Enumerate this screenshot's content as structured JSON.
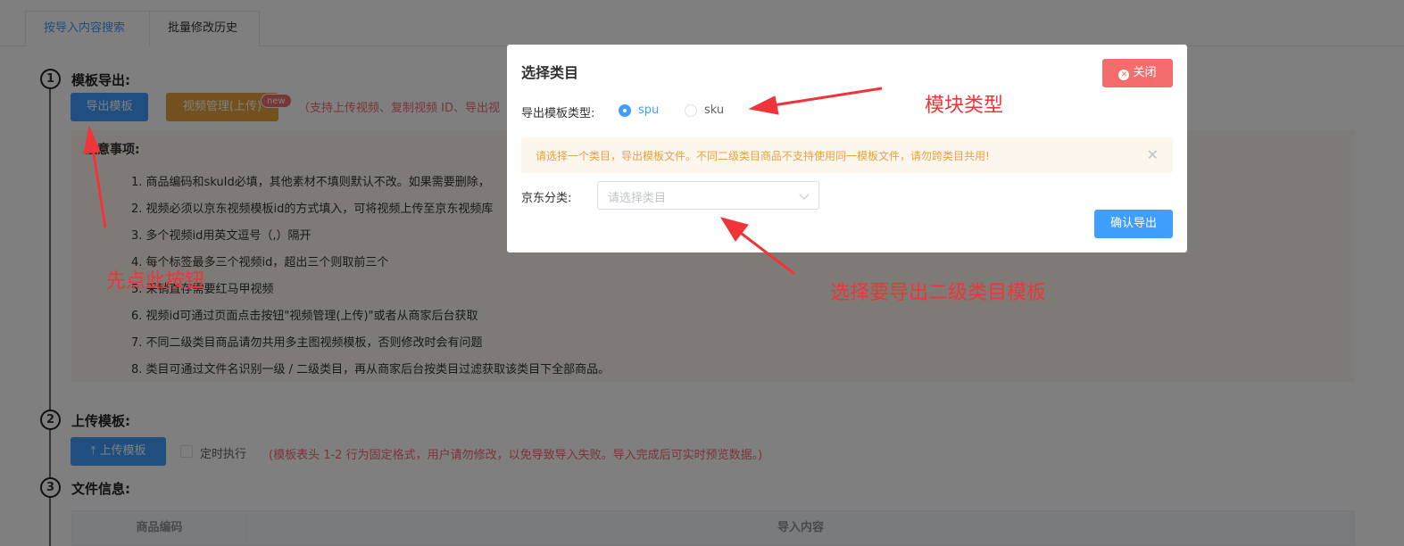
{
  "tabs": [
    {
      "label": "按导入内容搜索",
      "active": true
    },
    {
      "label": "批量修改历史",
      "active": false
    }
  ],
  "steps": [
    {
      "num": "1",
      "title": "模板导出:"
    },
    {
      "num": "2",
      "title": "上传模板:"
    },
    {
      "num": "3",
      "title": "文件信息:"
    }
  ],
  "step1": {
    "export_button": "导出模板",
    "video_button": "视频管理(上传)",
    "new_badge": "new",
    "hint": "（支持上传视频、复制视频 ID、导出视"
  },
  "notice": {
    "title": "注意事项:",
    "items": [
      "1. 商品编码和skuId必填，其他素材不填则默认不改。如果需要删除，",
      "2. 视频必须以京东视频模板id的方式填入，可将视频上传至京东视频库",
      "3. 多个视频id用英文逗号（,）隔开",
      "4. 每个标签最多三个视频id，超出三个则取前三个",
      "5. 采销直存需要红马甲视频",
      "6. 视频id可通过页面点击按钮\"视频管理(上传)\"或者从商家后台获取",
      "7. 不同二级类目商品请勿共用多主图视频模板，否则修改时会有问题",
      "8. 类目可通过文件名识别一级 / 二级类目，再从商家后台按类目过滤获取该类目下全部商品。"
    ]
  },
  "step2": {
    "upload_button": "上传模板",
    "checkbox_label": "定时执行",
    "hint": "(模板表头 1-2 行为固定格式，用户请勿修改，以免导致导入失败。导入完成后可实时预览数据。)"
  },
  "table": {
    "columns": [
      "商品编码",
      "导入内容"
    ]
  },
  "dialog": {
    "title": "选择类目",
    "close_label": "关闭",
    "type_label": "导出模板类型:",
    "options": [
      {
        "label": "spu",
        "checked": true
      },
      {
        "label": "sku",
        "checked": false
      }
    ],
    "alert": "请选择一个类目，导出模板文件。不同二级类目商品不支持使用同一模板文件，请勿跨类目共用!",
    "category_label": "京东分类:",
    "select_placeholder": "请选择类目",
    "confirm_button": "确认导出"
  },
  "annotations": {
    "module_type": "模块类型",
    "select_category": "选择要导出二级类目模板",
    "click_first": "先点此按钮"
  },
  "colors": {
    "primary": "#409eff",
    "warning": "#e6a23c",
    "danger": "#f56c6c",
    "annotation": "#f0343a"
  }
}
